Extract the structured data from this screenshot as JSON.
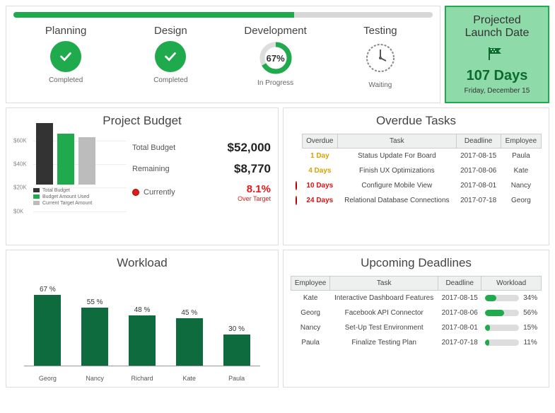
{
  "progress_overall_pct": 67,
  "phases": [
    {
      "title": "Planning",
      "status": "Completed",
      "type": "check"
    },
    {
      "title": "Design",
      "status": "Completed",
      "type": "check"
    },
    {
      "title": "Development",
      "status": "In Progress",
      "type": "donut",
      "pct": "67%"
    },
    {
      "title": "Testing",
      "status": "Waiting",
      "type": "clock"
    }
  ],
  "launch": {
    "title1": "Projected",
    "title2": "Launch Date",
    "days": "107 Days",
    "date": "Friday, December 15"
  },
  "budget": {
    "title": "Project Budget",
    "total_label": "Total Budget",
    "total_val": "$52,000",
    "remain_label": "Remaining",
    "remain_val": "$8,770",
    "curr_label": "Currently",
    "over_pct": "8.1%",
    "over_sub": "Over Target",
    "ticks": [
      "$60K",
      "$40K",
      "$20K",
      "$0K"
    ],
    "legend": [
      "Total Budget",
      "Budget Amount Used",
      "Current Target Amount"
    ]
  },
  "chart_data": [
    {
      "type": "bar",
      "title": "Project Budget",
      "categories": [
        "Total Budget",
        "Budget Amount Used",
        "Current Target Amount"
      ],
      "values": [
        52000,
        43230,
        40000
      ],
      "ylim": [
        0,
        60000
      ],
      "ylabel": "$",
      "colors": [
        "#333333",
        "#1fab4d",
        "#bcbcbc"
      ]
    },
    {
      "type": "bar",
      "title": "Workload",
      "categories": [
        "Georg",
        "Nancy",
        "Richard",
        "Kate",
        "Paula"
      ],
      "values": [
        67,
        55,
        48,
        45,
        30
      ],
      "ylim": [
        0,
        100
      ],
      "ylabel": "%"
    }
  ],
  "overdue": {
    "title": "Overdue Tasks",
    "headers": [
      "Overdue",
      "Task",
      "Deadline",
      "Employee"
    ],
    "rows": [
      {
        "sev": "warn",
        "overdue": "1 Day",
        "task": "Status Update For Board",
        "deadline": "2017-08-15",
        "emp": "Paula"
      },
      {
        "sev": "warn",
        "overdue": "4 Days",
        "task": "Finish UX Optimizations",
        "deadline": "2017-08-06",
        "emp": "Kate"
      },
      {
        "sev": "crit",
        "overdue": "10 Days",
        "task": "Configure Mobile View",
        "deadline": "2017-08-01",
        "emp": "Nancy"
      },
      {
        "sev": "crit",
        "overdue": "24 Days",
        "task": "Relational Database Connections",
        "deadline": "2017-07-18",
        "emp": "Georg"
      }
    ]
  },
  "workload": {
    "title": "Workload",
    "items": [
      {
        "name": "Georg",
        "pct": 67,
        "label": "67 %"
      },
      {
        "name": "Nancy",
        "pct": 55,
        "label": "55 %"
      },
      {
        "name": "Richard",
        "pct": 48,
        "label": "48 %"
      },
      {
        "name": "Kate",
        "pct": 45,
        "label": "45 %"
      },
      {
        "name": "Paula",
        "pct": 30,
        "label": "30 %"
      }
    ]
  },
  "deadlines": {
    "title": "Upcoming Deadlines",
    "headers": [
      "Employee",
      "Task",
      "Deadline",
      "Workload"
    ],
    "rows": [
      {
        "emp": "Kate",
        "task": "Interactive Dashboard Features",
        "deadline": "2017-08-15",
        "pct": 34,
        "pct_label": "34%"
      },
      {
        "emp": "Georg",
        "task": "Facebook API Connector",
        "deadline": "2017-08-06",
        "pct": 56,
        "pct_label": "56%"
      },
      {
        "emp": "Nancy",
        "task": "Set-Up Test Environment",
        "deadline": "2017-08-01",
        "pct": 15,
        "pct_label": "15%"
      },
      {
        "emp": "Paula",
        "task": "Finalize Testing Plan",
        "deadline": "2017-07-18",
        "pct": 11,
        "pct_label": "11%"
      }
    ]
  }
}
